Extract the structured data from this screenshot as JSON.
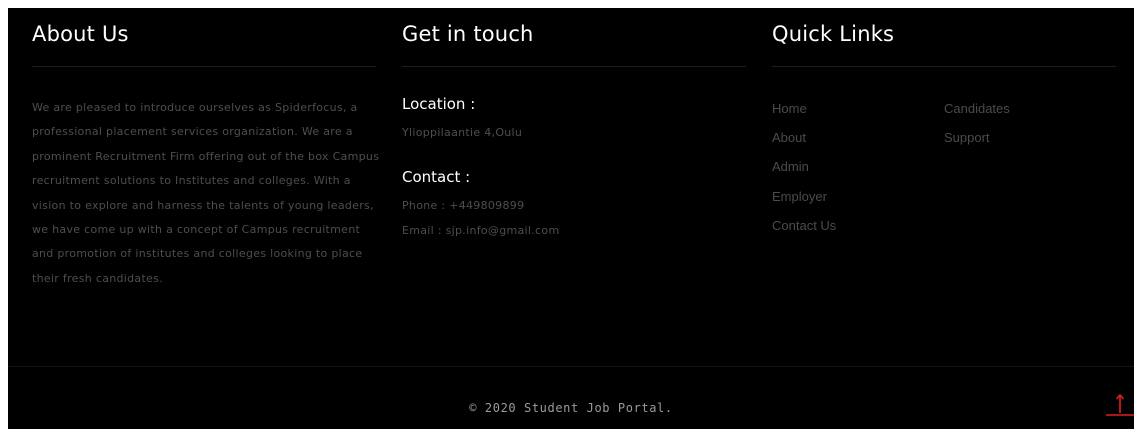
{
  "about": {
    "title": "About Us",
    "text": "We are pleased to introduce ourselves as Spiderfocus, a professional placement services organization. We are a prominent Recruitment Firm offering out of the box Campus recruitment solutions to Institutes and colleges. With a vision to explore and harness the talents of young leaders, we have come up with a concept of Campus recruitment and promotion of institutes and colleges looking to place their fresh candidates."
  },
  "contact": {
    "title": "Get in touch",
    "location_heading": "Location :",
    "location_value": "Ylioppilaantie 4,Oulu",
    "contact_heading": "Contact :",
    "phone": "Phone : +449809899",
    "email": "Email : sjp.info@gmail.com"
  },
  "quick_links": {
    "title": "Quick Links",
    "left": [
      "Home",
      "About",
      "Admin",
      "Employer",
      "Contact Us"
    ],
    "right": [
      "Candidates",
      "Support"
    ]
  },
  "copyright": "© 2020 Student Job Portal.",
  "colors": {
    "background": "#000000",
    "text_muted": "#4e4e4e",
    "heading": "#ffffff",
    "accent": "#e0201e"
  },
  "icons": {
    "back_to_top": "arrow-up-icon"
  }
}
